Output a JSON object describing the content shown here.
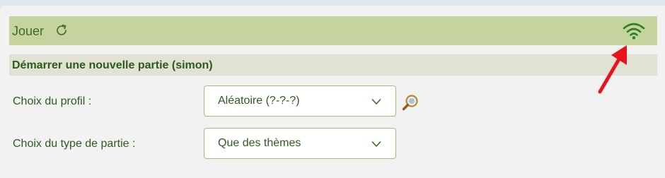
{
  "header": {
    "title": "Jouer",
    "refresh_icon": "refresh-icon",
    "status_icon": "wifi-icon",
    "accent_color": "#c5d49e",
    "title_color": "#3c6a22"
  },
  "section": {
    "title": "Démarrer une nouvelle partie (simon)"
  },
  "form": {
    "profile": {
      "label": "Choix du profil :",
      "value": "Aléatoire (?-?-?)",
      "action_icon": "magnifier-icon"
    },
    "game_type": {
      "label": "Choix du type de partie :",
      "value": "Que des thèmes"
    }
  },
  "annotation": {
    "arrow_color": "#e8141b"
  }
}
